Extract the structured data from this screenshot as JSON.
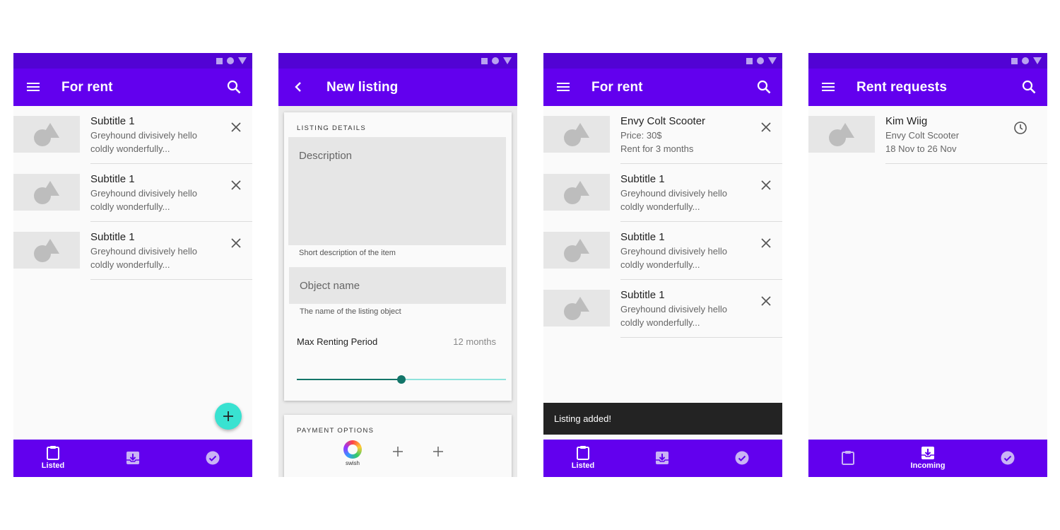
{
  "screens": [
    {
      "appbar": {
        "title": "For rent",
        "left_icon": "menu-icon",
        "right_icon": "search-icon"
      },
      "items": [
        {
          "title": "Subtitle 1",
          "line1": "Greyhound divisively hello",
          "line2": "coldly wonderfully...",
          "action_icon": "close-icon"
        },
        {
          "title": "Subtitle 1",
          "line1": "Greyhound divisively hello",
          "line2": "coldly wonderfully...",
          "action_icon": "close-icon"
        },
        {
          "title": "Subtitle 1",
          "line1": "Greyhound divisively hello",
          "line2": "coldly wonderfully...",
          "action_icon": "close-icon"
        }
      ],
      "fab_icon": "plus-icon",
      "nav": [
        {
          "label": "Listed",
          "icon": "clipboard-icon",
          "active": true
        },
        {
          "label": "",
          "icon": "inbox-icon",
          "active": false
        },
        {
          "label": "",
          "icon": "check-circle-icon",
          "active": false
        }
      ]
    },
    {
      "appbar": {
        "title": "New listing",
        "left_icon": "back-chevron-icon"
      },
      "listing_card": {
        "overline": "LISTING DETAILS",
        "description_placeholder": "Description",
        "description_helper": "Short description of the item",
        "object_name_placeholder": "Object name",
        "object_name_helper": "The name of the listing object",
        "max_period_label": "Max Renting Period",
        "max_period_value": "12 months",
        "slider_fraction": 0.5
      },
      "payment_card": {
        "overline": "PAYMENT OPTIONS",
        "swish_label": "swish"
      }
    },
    {
      "appbar": {
        "title": "For rent",
        "left_icon": "menu-icon",
        "right_icon": "search-icon"
      },
      "items": [
        {
          "title": "Envy Colt Scooter",
          "line1": "Price: 30$",
          "line2": "Rent for 3 months",
          "action_icon": "close-icon"
        },
        {
          "title": "Subtitle 1",
          "line1": "Greyhound divisively hello",
          "line2": "coldly wonderfully...",
          "action_icon": "close-icon"
        },
        {
          "title": "Subtitle 1",
          "line1": "Greyhound divisively hello",
          "line2": "coldly wonderfully...",
          "action_icon": "close-icon"
        },
        {
          "title": "Subtitle 1",
          "line1": "Greyhound divisively hello",
          "line2": "coldly wonderfully...",
          "action_icon": "close-icon"
        }
      ],
      "snackbar": "Listing added!",
      "nav": [
        {
          "label": "Listed",
          "icon": "clipboard-icon",
          "active": true
        },
        {
          "label": "",
          "icon": "inbox-icon",
          "active": false
        },
        {
          "label": "",
          "icon": "check-circle-icon",
          "active": false
        }
      ]
    },
    {
      "appbar": {
        "title": "Rent requests",
        "left_icon": "menu-icon",
        "right_icon": "search-icon"
      },
      "items": [
        {
          "title": "Kim Wiig",
          "line1": "Envy Colt Scooter",
          "line2": "18 Nov to 26 Nov",
          "action_icon": "clock-icon"
        }
      ],
      "nav": [
        {
          "label": "",
          "icon": "clipboard-icon",
          "active": false
        },
        {
          "label": "Incoming",
          "icon": "inbox-icon",
          "active": true
        },
        {
          "label": "",
          "icon": "check-circle-icon",
          "active": false
        }
      ]
    }
  ],
  "colors": {
    "primary": "#6200ee",
    "status_bar": "#5203d4",
    "fab": "#39e2d1",
    "slider": "#137569",
    "snackbar": "#232323"
  }
}
